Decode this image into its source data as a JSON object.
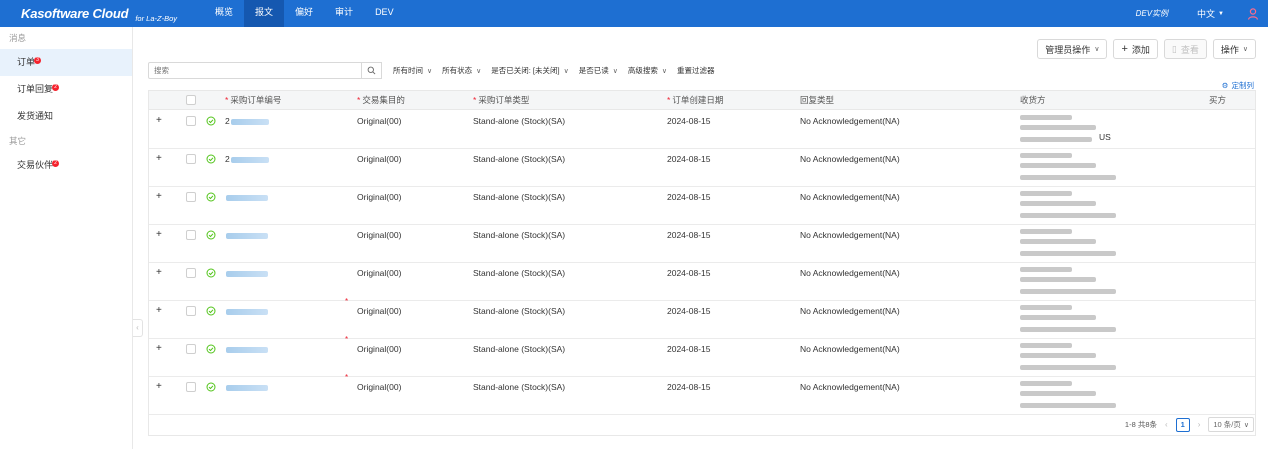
{
  "topbar": {
    "brand": "Kasoftware Cloud",
    "brand_sub": "for La-Z-Boy",
    "nav": [
      "概览",
      "报文",
      "偏好",
      "审计",
      "DEV"
    ],
    "active_nav": 1,
    "instance": "DEV实例",
    "language": "中文",
    "accent_color": "#1e6fd2"
  },
  "sidebar": {
    "group_messages": "消息",
    "items_messages": [
      {
        "label": "订单",
        "badge": "3"
      },
      {
        "label": "订单回复",
        "badge": "2"
      },
      {
        "label": "发货通知",
        "badge": ""
      }
    ],
    "group_other": "其它",
    "items_other": [
      {
        "label": "交易伙伴",
        "badge": "2"
      }
    ]
  },
  "actions": {
    "admin": "管理员操作",
    "add": "添加",
    "view": "查看",
    "operate": "操作"
  },
  "filters": {
    "search_placeholder": "搜索",
    "time": "所有时间",
    "status": "所有状态",
    "closed": "是否已关闭: [未关闭]",
    "read": "是否已读",
    "advanced": "高级搜索",
    "reset": "重置过滤器"
  },
  "custom_columns": "定制列",
  "table": {
    "headers": {
      "po_number": "采购订单编号",
      "purpose": "交易集目的",
      "po_type": "采购订单类型",
      "created": "订单创建日期",
      "ack_type": "回复类型",
      "ship_to": "收货方",
      "buyer": "买方"
    },
    "rows": [
      {
        "po_prefix": "2",
        "purpose": "Original(00)",
        "purpose_flag": false,
        "po_type": "Stand-alone (Stock)(SA)",
        "created": "2024-08-15",
        "ack_type": "No Acknowledgement(NA)",
        "ship_country": "US"
      },
      {
        "po_prefix": "2",
        "purpose": "Original(00)",
        "purpose_flag": false,
        "po_type": "Stand-alone (Stock)(SA)",
        "created": "2024-08-15",
        "ack_type": "No Acknowledgement(NA)",
        "ship_country": ""
      },
      {
        "po_prefix": "",
        "purpose": "Original(00)",
        "purpose_flag": false,
        "po_type": "Stand-alone (Stock)(SA)",
        "created": "2024-08-15",
        "ack_type": "No Acknowledgement(NA)",
        "ship_country": ""
      },
      {
        "po_prefix": "",
        "purpose": "Original(00)",
        "purpose_flag": false,
        "po_type": "Stand-alone (Stock)(SA)",
        "created": "2024-08-15",
        "ack_type": "No Acknowledgement(NA)",
        "ship_country": ""
      },
      {
        "po_prefix": "",
        "purpose": "Original(00)",
        "purpose_flag": false,
        "po_type": "Stand-alone (Stock)(SA)",
        "created": "2024-08-15",
        "ack_type": "No Acknowledgement(NA)",
        "ship_country": ""
      },
      {
        "po_prefix": "",
        "purpose": "Original(00)",
        "purpose_flag": true,
        "po_type": "Stand-alone (Stock)(SA)",
        "created": "2024-08-15",
        "ack_type": "No Acknowledgement(NA)",
        "ship_country": ""
      },
      {
        "po_prefix": "",
        "purpose": "Original(00)",
        "purpose_flag": true,
        "po_type": "Stand-alone (Stock)(SA)",
        "created": "2024-08-15",
        "ack_type": "No Acknowledgement(NA)",
        "ship_country": ""
      },
      {
        "po_prefix": "",
        "purpose": "Original(00)",
        "purpose_flag": true,
        "po_type": "Stand-alone (Stock)(SA)",
        "created": "2024-08-15",
        "ack_type": "No Acknowledgement(NA)",
        "ship_country": ""
      }
    ]
  },
  "pagination": {
    "summary": "1-8 共8条",
    "current": "1",
    "page_size": "10 条/页"
  }
}
